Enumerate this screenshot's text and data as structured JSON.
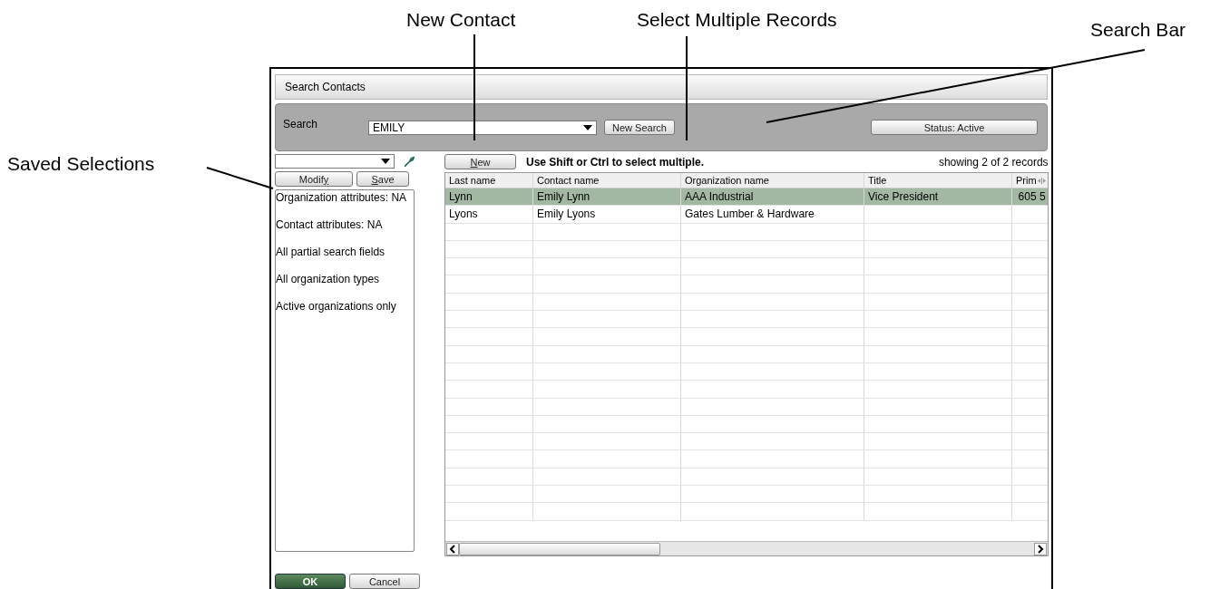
{
  "annotations": [
    {
      "text": "New Contact",
      "kind": "new"
    },
    {
      "text": "Select Multiple Records",
      "kind": "multi"
    },
    {
      "text": "Search Bar",
      "kind": "search"
    },
    {
      "text": "Saved Selections",
      "kind": "saved"
    }
  ],
  "window": {
    "title": "Search Contacts"
  },
  "search_bar": {
    "label": "Search",
    "value": "EMILY",
    "new_search_button": "New Search",
    "status_button": "Status: Active"
  },
  "saved_selections": {
    "modify_button": {
      "pre": "Modif",
      "key": "y"
    },
    "save_button": {
      "key": "S",
      "post": "ave"
    },
    "items": [
      "Organization attributes: NA",
      "Contact attributes: NA",
      "All partial search fields",
      "All organization types",
      "Active organizations only"
    ]
  },
  "toolbar": {
    "new_button": {
      "key": "N",
      "post": "ew"
    },
    "hint": "Use Shift or Ctrl to select multiple.",
    "record_count": "showing 2 of 2 records"
  },
  "table": {
    "columns": [
      "Last name",
      "Contact name",
      "Organization name",
      "Title",
      "Prim"
    ],
    "rows": [
      {
        "selected": true,
        "cells": [
          "Lynn",
          "Emily Lynn",
          "AAA Industrial",
          "Vice President",
          "605 5"
        ]
      },
      {
        "selected": false,
        "cells": [
          "Lyons",
          "Emily Lyons",
          "Gates Lumber & Hardware",
          null,
          null
        ]
      }
    ]
  },
  "buttons": {
    "ok": "OK",
    "cancel": "Cancel"
  }
}
